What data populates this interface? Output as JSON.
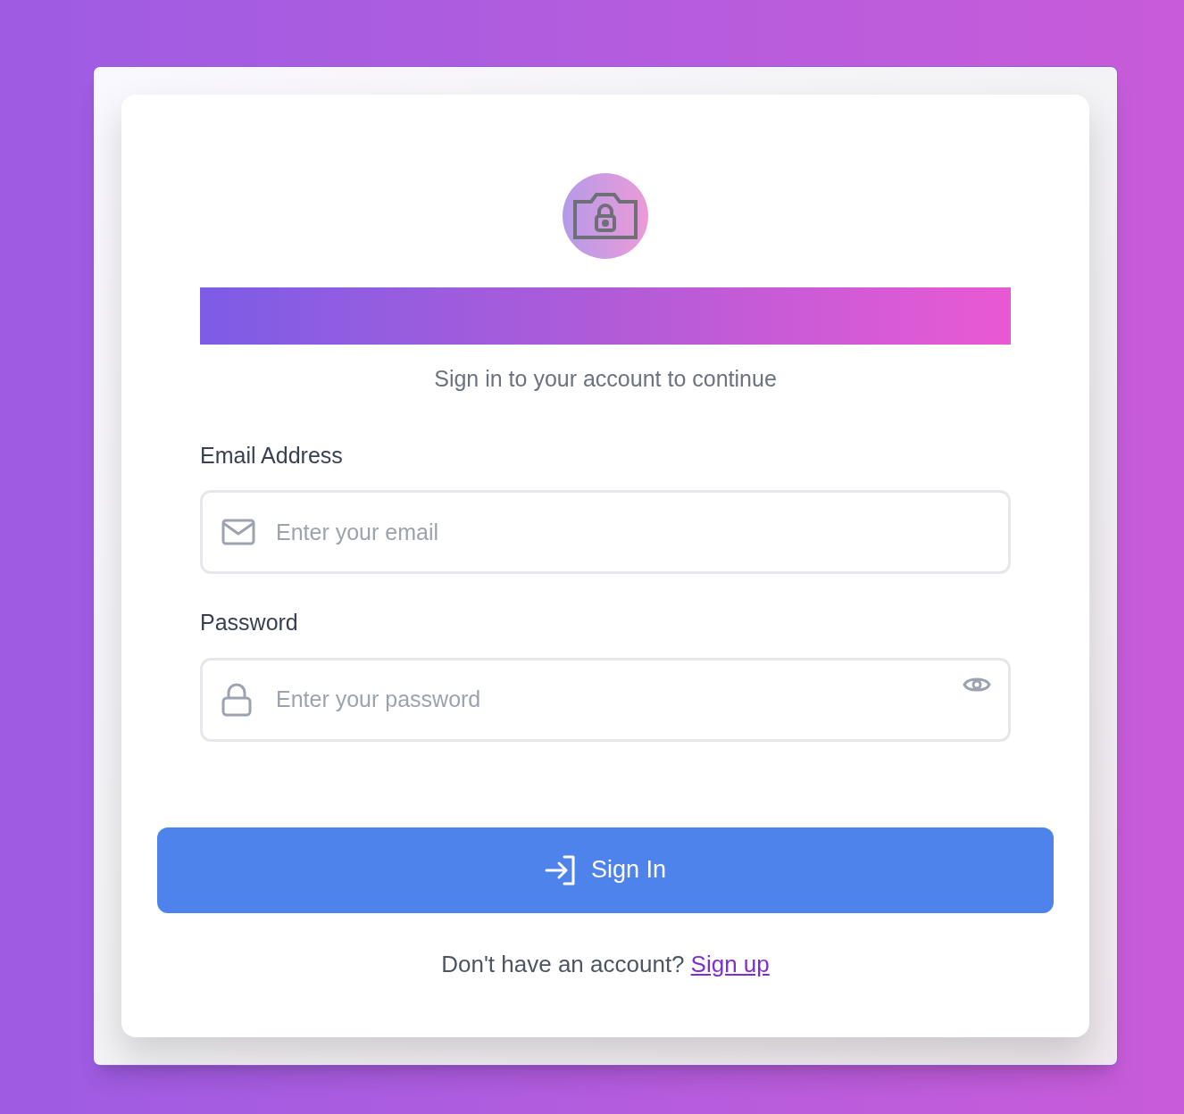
{
  "subtitle": "Sign in to your account to continue",
  "fields": [
    {
      "kind": "email",
      "label": "Email Address",
      "placeholder": "Enter your email"
    },
    {
      "kind": "password",
      "label": "Password",
      "placeholder": "Enter your password"
    }
  ],
  "button": {
    "label": "Sign In"
  },
  "footer": {
    "text": "Don't have an account?",
    "link": "Sign up"
  }
}
